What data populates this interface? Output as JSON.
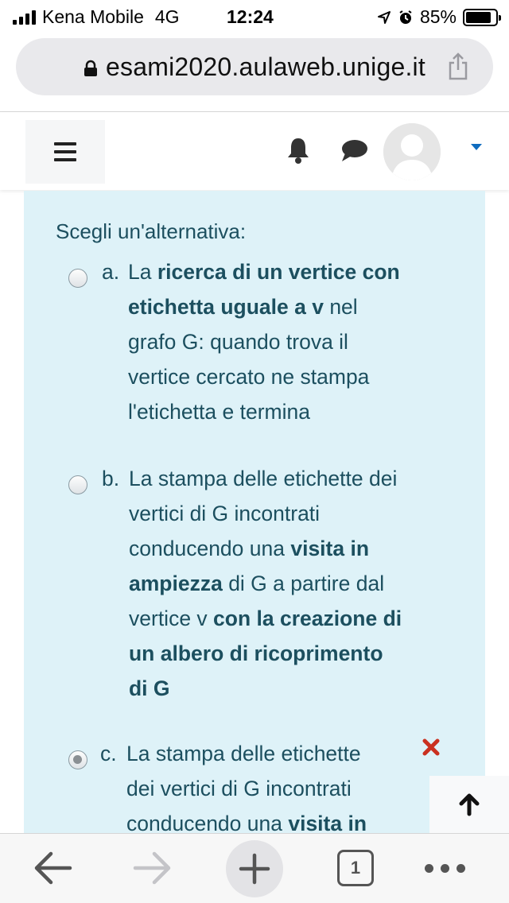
{
  "status_bar": {
    "carrier": "Kena Mobile",
    "network": "4G",
    "time": "12:24",
    "battery": "85%",
    "battery_level": 0.85
  },
  "browser": {
    "url": "esami2020.aulaweb.unige.it",
    "tab_count": "1"
  },
  "header": {
    "menu_icon": "hamburger-icon",
    "notifications_icon": "bell-icon",
    "messages_icon": "chat-bubble-icon",
    "user_icon": "user-avatar"
  },
  "question": {
    "prompt": "Scegli un'alternativa:",
    "options": [
      {
        "letter": "a.",
        "selected": false,
        "lines": [
          [
            {
              "t": "La ",
              "b": false
            },
            {
              "t": "ricerca di un vertice con",
              "b": true
            }
          ],
          [
            {
              "t": "etichetta uguale a v",
              "b": true
            },
            {
              "t": " nel",
              "b": false
            }
          ],
          [
            {
              "t": "grafo G: quando trova il",
              "b": false
            }
          ],
          [
            {
              "t": "vertice cercato ne stampa",
              "b": false
            }
          ],
          [
            {
              "t": "l'etichetta e termina",
              "b": false
            }
          ]
        ]
      },
      {
        "letter": "b.",
        "selected": false,
        "lines": [
          [
            {
              "t": "La stampa delle etichette dei",
              "b": false
            }
          ],
          [
            {
              "t": "vertici di G incontrati",
              "b": false
            }
          ],
          [
            {
              "t": "conducendo una ",
              "b": false
            },
            {
              "t": "visita in",
              "b": true
            }
          ],
          [
            {
              "t": "ampiezza",
              "b": true
            },
            {
              "t": " di G a partire dal",
              "b": false
            }
          ],
          [
            {
              "t": "vertice v ",
              "b": false
            },
            {
              "t": "con la creazione di",
              "b": true
            }
          ],
          [
            {
              "t": "un albero di ricoprimento",
              "b": true
            }
          ],
          [
            {
              "t": "di G",
              "b": true
            }
          ]
        ]
      },
      {
        "letter": "c.",
        "selected": true,
        "incorrect": true,
        "lines": [
          [
            {
              "t": "La stampa delle etichette",
              "b": false
            }
          ],
          [
            {
              "t": "dei vertici di G incontrati",
              "b": false
            }
          ],
          [
            {
              "t": "conducendo una ",
              "b": false
            },
            {
              "t": "visita in",
              "b": true
            }
          ]
        ]
      }
    ]
  },
  "colors": {
    "panel_bg": "#def2f8",
    "text": "#1c4f5f",
    "accent": "#0f6cbf",
    "incorrect": "#ca3120"
  }
}
